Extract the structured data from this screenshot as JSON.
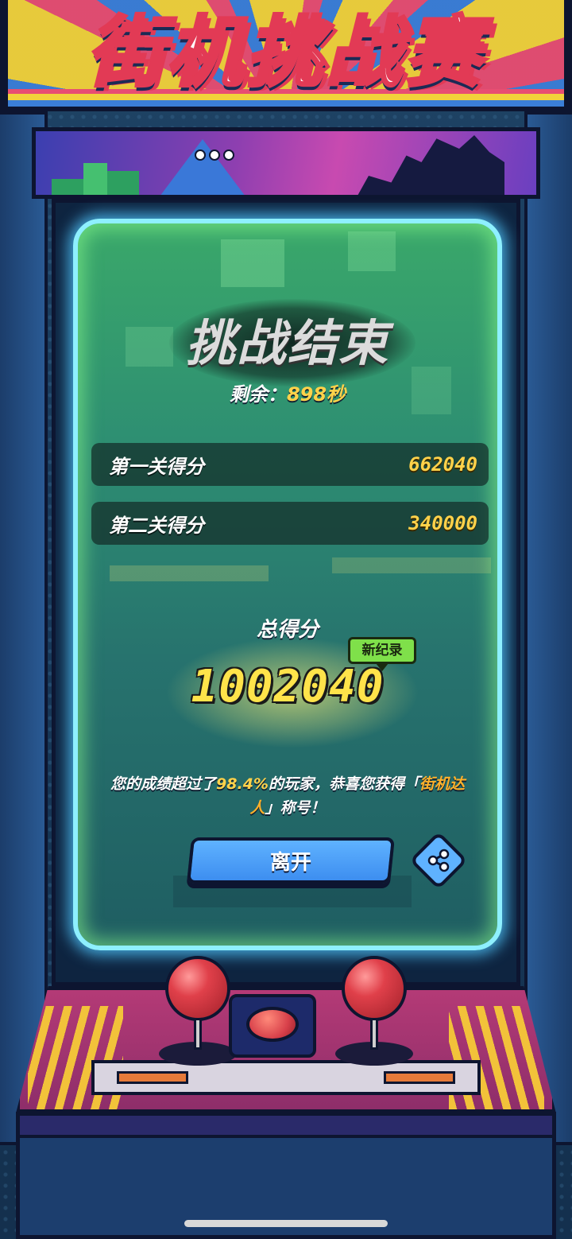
{
  "marquee": {
    "title": "街机挑战赛"
  },
  "result": {
    "title": "挑战结束",
    "remaining_label": "剩余：",
    "remaining_value": "898秒",
    "scores": [
      {
        "label": "第一关得分",
        "value": "662040"
      },
      {
        "label": "第二关得分",
        "value": "340000"
      }
    ],
    "total_label": "总得分",
    "total_value": "1002040",
    "new_record_badge": "新纪录",
    "congrats_prefix": "您的成绩超过了",
    "congrats_percent": "98.4%",
    "congrats_middle": "的玩家，恭喜您获得「",
    "congrats_honor": "街机达人",
    "congrats_suffix": "」称号！"
  },
  "actions": {
    "leave_label": "离开",
    "share_icon": "share-icon"
  },
  "colors": {
    "score_yellow": "#ffd24a",
    "button_blue": "#3d8ef0",
    "badge_green": "#7fe04a",
    "screen_glow": "#8ef0ff"
  }
}
